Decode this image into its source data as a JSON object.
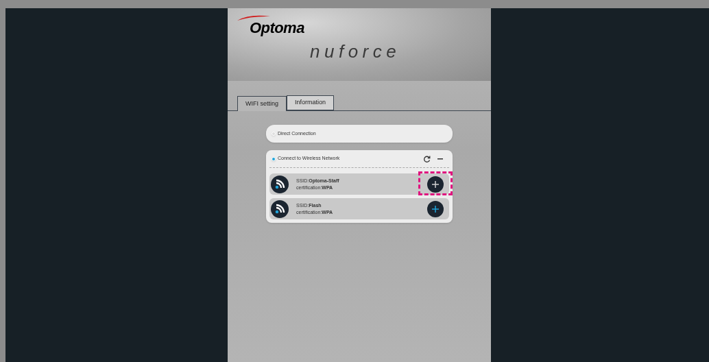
{
  "header": {
    "brand": "Optoma",
    "product": "nuforce"
  },
  "tabs": [
    {
      "label": "WIFI setting",
      "selected": true
    },
    {
      "label": "Information",
      "selected": false
    }
  ],
  "modes": [
    {
      "label": "Direct Connection",
      "selected": false
    },
    {
      "label": "Connect to Wireless Network",
      "selected": true
    }
  ],
  "networks": [
    {
      "ssid_label": "SSID:",
      "ssid": "Optoma-Staff",
      "cert_label": "certification:",
      "cert": "WPA",
      "highlighted": true
    },
    {
      "ssid_label": "SSID:",
      "ssid": "Flash",
      "cert_label": "certification:",
      "cert": "WPA",
      "highlighted": false
    }
  ]
}
